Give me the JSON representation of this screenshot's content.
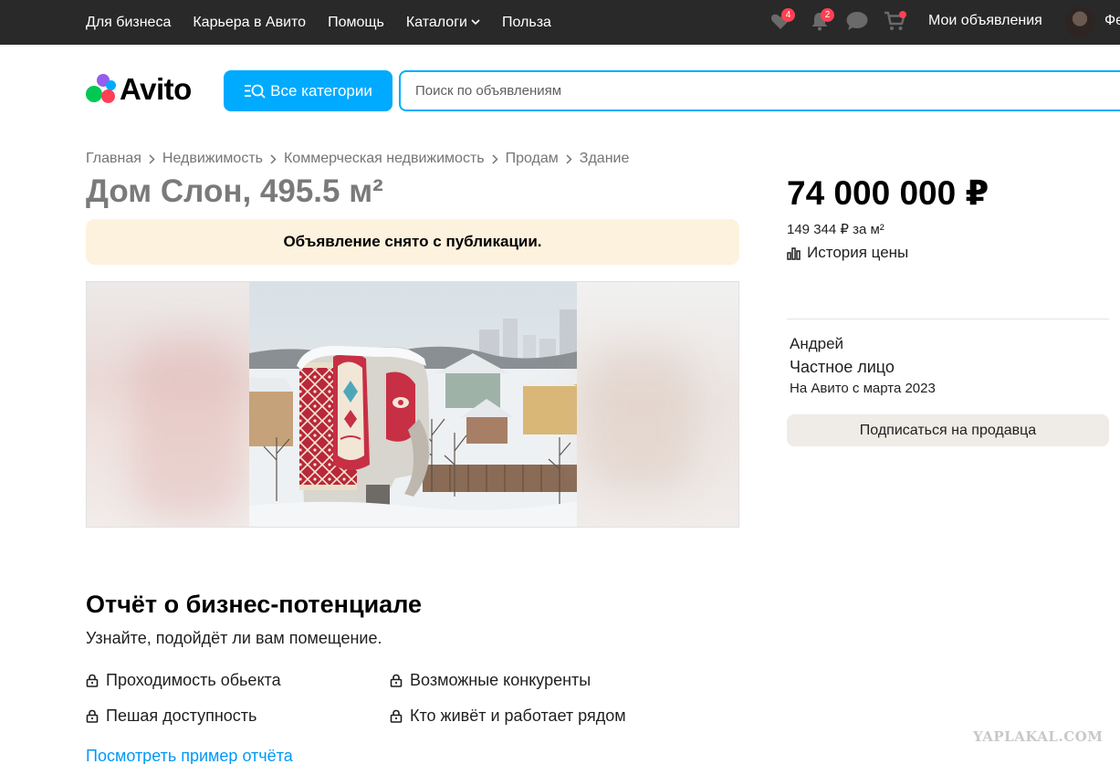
{
  "topbar": {
    "links": [
      "Для бизнеса",
      "Карьера в Авито",
      "Помощь",
      "Каталоги",
      "Польза"
    ],
    "favorites_count": "4",
    "notifications_count": "2",
    "my_ads_label": "Мои объявления",
    "user_name_fragment": "Фе"
  },
  "header": {
    "logo_text": "Avito",
    "categories_button": "Все категории",
    "search_placeholder": "Поиск по объявлениям"
  },
  "breadcrumb": [
    "Главная",
    "Недвижимость",
    "Коммерческая недвижимость",
    "Продам",
    "Здание"
  ],
  "listing": {
    "title": "Дом Слон, 495.5 м²",
    "notice": "Объявление снято с публикации.",
    "price": "74 000 000 ₽",
    "price_per_m2": "149 344 ₽ за м²",
    "price_history_label": "История цены"
  },
  "seller": {
    "name": "Андрей",
    "type": "Частное лицо",
    "since": "На Авито с марта 2023",
    "subscribe_label": "Подписаться на продавца"
  },
  "report": {
    "title": "Отчёт о бизнес-потенциале",
    "subtitle": "Узнайте, подойдёт ли вам помещение.",
    "features": [
      "Проходимость обьекта",
      "Возможные конкуренты",
      "Пешая доступность",
      "Кто живёт и работает рядом"
    ],
    "sample_link": "Посмотреть пример отчёта"
  },
  "watermark": "YAPLAKAL.COM",
  "colors": {
    "topbar_bg": "#292929",
    "accent_blue": "#00aaff",
    "badge_red": "#ff4053",
    "notice_bg": "#fdf2dd",
    "subscribe_bg": "#efebe6"
  },
  "icons": [
    "heart-icon",
    "bell-icon",
    "chat-icon",
    "cart-icon",
    "chevron-down-icon",
    "search-list-icon",
    "chart-icon",
    "lock-icon",
    "chevron-right-icon"
  ]
}
